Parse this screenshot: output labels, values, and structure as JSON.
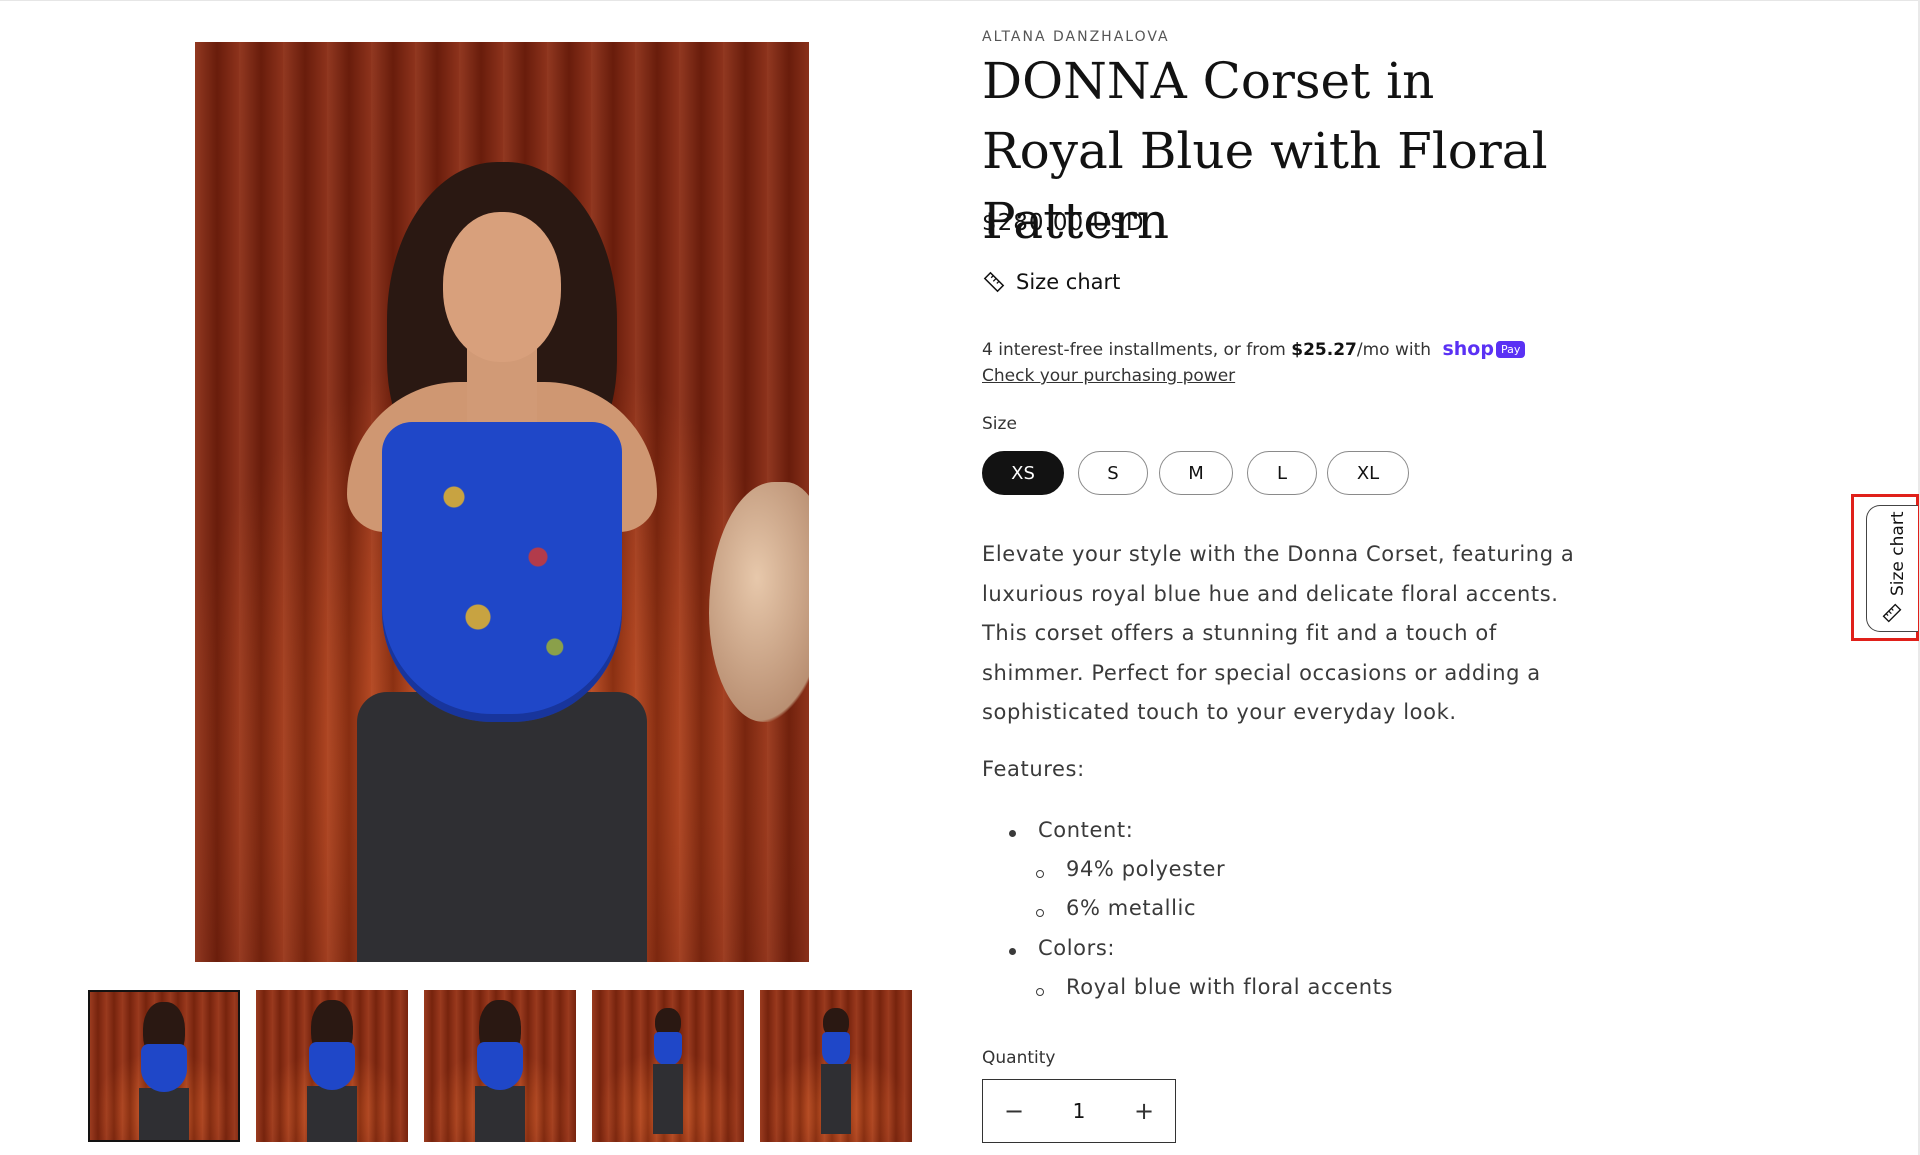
{
  "product": {
    "vendor": "ALTANA DANZHALOVA",
    "title": "DONNA Corset in Royal Blue with Floral Pattern",
    "price": "$280.00 USD",
    "size_chart_label": "Size chart",
    "installments": {
      "prefix": "4 interest-free installments, or from ",
      "amount": "$25.27",
      "suffix": "/mo with",
      "brand": "shop",
      "badge": "Pay",
      "link": "Check your purchasing power"
    },
    "size": {
      "label": "Size",
      "options": [
        "XS",
        "S",
        "M",
        "L",
        "XL"
      ],
      "selected": "XS"
    },
    "description": "Elevate your style with the Donna Corset, featuring a luxurious royal blue hue and delicate floral accents. This corset offers a stunning fit and a touch of shimmer. Perfect for special occasions or adding a sophisticated touch to your everyday look.",
    "features": {
      "heading": "Features:",
      "items": [
        {
          "label": "Content:",
          "sub": [
            "94% polyester",
            "6% metallic"
          ]
        },
        {
          "label": "Colors:",
          "sub": [
            "Royal blue with floral accents"
          ]
        }
      ]
    },
    "quantity": {
      "label": "Quantity",
      "value": "1",
      "decrease": "−",
      "increase": "+"
    }
  },
  "gallery": {
    "thumbnail_count": 5,
    "active_index": 0
  },
  "floating_tab": {
    "label": "Size chart",
    "icon": "ruler-icon"
  }
}
